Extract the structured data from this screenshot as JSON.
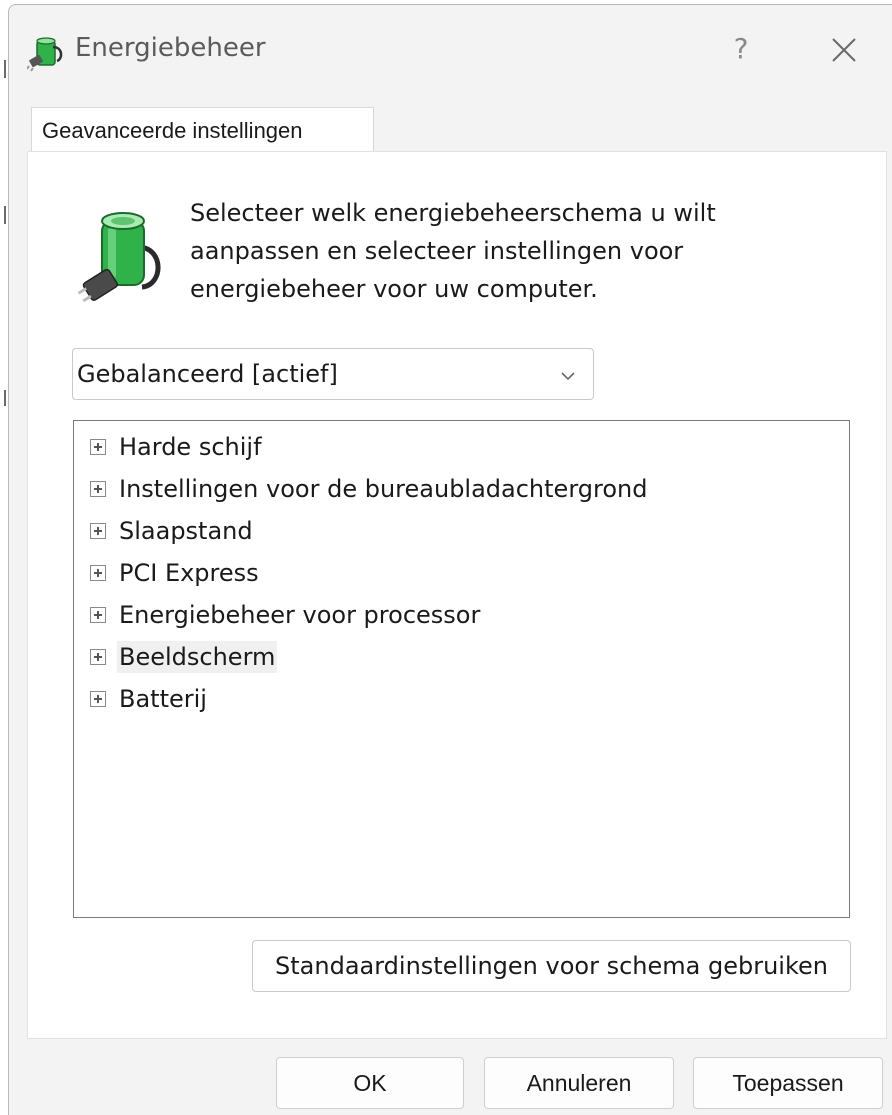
{
  "window": {
    "title": "Energiebeheer",
    "help_label": "?"
  },
  "tabs": [
    {
      "label": "Geavanceerde instellingen",
      "selected": true
    }
  ],
  "panel": {
    "description": "Selecteer welk energiebeheerschema u wilt aanpassen en selecteer instellingen voor energiebeheer voor uw computer.",
    "description_lines": [
      "Selecteer welk energiebeheerschema u wilt",
      "aanpassen en selecteer instellingen voor",
      "energiebeheer voor uw computer."
    ],
    "scheme_select": {
      "value": "Gebalanceerd [actief]"
    },
    "tree_items": [
      {
        "label": "Harde schijf"
      },
      {
        "label": "Instellingen voor de bureaubladachtergrond"
      },
      {
        "label": "Slaapstand"
      },
      {
        "label": "PCI Express"
      },
      {
        "label": "Energiebeheer voor processor"
      },
      {
        "label": "Beeldscherm",
        "highlighted": true
      },
      {
        "label": "Batterij"
      }
    ],
    "restore_defaults_label": "Standaardinstellingen voor schema gebruiken"
  },
  "buttons": {
    "ok": "OK",
    "cancel": "Annuleren",
    "apply": "Toepassen"
  },
  "colors": {
    "battery_green": "#2fb24a",
    "window_bg": "#f3f3f3",
    "selection_bg": "#f0f0f0"
  }
}
